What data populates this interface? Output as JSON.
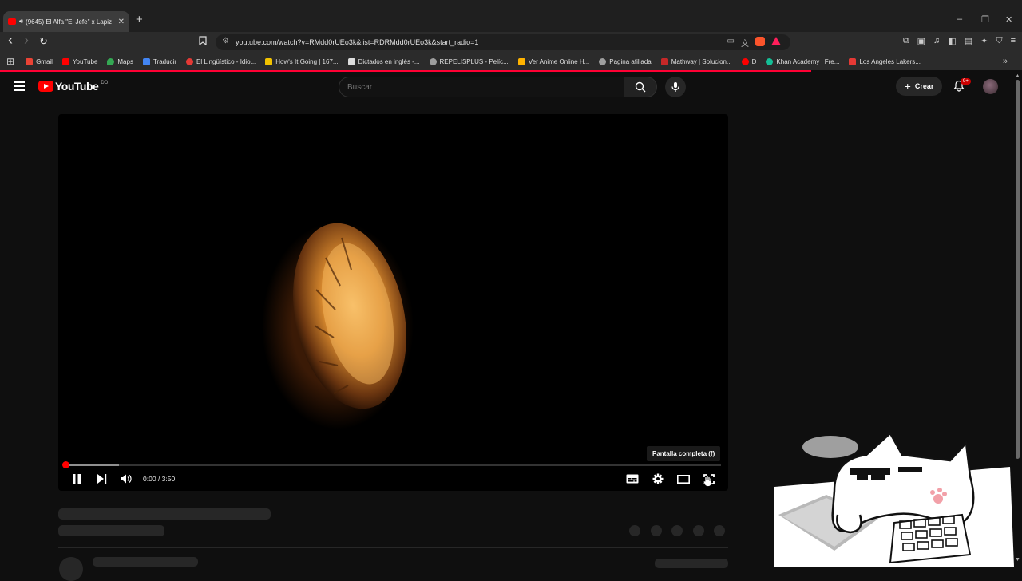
{
  "browser": {
    "tab": {
      "speaker_icon": "speaker-icon",
      "title": "(9645) El Alfa \"El Jefe\" x Lapiz",
      "close": "✕"
    },
    "new_tab": "+",
    "window_controls": [
      "–",
      "❐",
      "✕"
    ],
    "nav": {
      "back": "‹",
      "forward": "›",
      "reload": "↻"
    },
    "url": "youtube.com/watch?v=RMdd0rUEo3k&list=RDRMdd0rUEo3k&start_radio=1",
    "bookmarks": [
      {
        "label": "Gmail",
        "color": "#ea4335"
      },
      {
        "label": "YouTube",
        "color": "#ff0000"
      },
      {
        "label": "Maps",
        "color": "#34a853"
      },
      {
        "label": "Traducir",
        "color": "#4285f4"
      },
      {
        "label": "El Lingüístico - Idio...",
        "color": "#e53935"
      },
      {
        "label": "How's It Going | 167...",
        "color": "#f2c200"
      },
      {
        "label": "Dictados en inglés -...",
        "color": "#dddddd"
      },
      {
        "label": "REPELISPLUS - Pelíc...",
        "color": "#9e9e9e"
      },
      {
        "label": "Ver Anime Online H...",
        "color": "#ffb300"
      },
      {
        "label": "Pagina afiliada",
        "color": "#9e9e9e"
      },
      {
        "label": "Mathway | Solucion...",
        "color": "#c62828"
      },
      {
        "label": "D",
        "color": "#ff0000"
      },
      {
        "label": "Khan Academy | Fre...",
        "color": "#14bf96"
      },
      {
        "label": "Los Angeles Lakers...",
        "color": "#e53935"
      }
    ],
    "bookmarks_overflow": "»"
  },
  "youtube": {
    "logo_text": "YouTube",
    "country_code": "DO",
    "search_placeholder": "Buscar",
    "create_label": "Crear",
    "notifications_badge": "9+"
  },
  "player": {
    "tooltip": "Pantalla completa (f)",
    "current_time": "0:00",
    "duration": "3:50",
    "time_display": "0:00 / 3:50",
    "progress_fraction": 0.0,
    "buffer_fraction": 0.08,
    "state": "playing"
  },
  "colors": {
    "accent": "#ff0000",
    "background": "#0f0f0f",
    "surface": "#272727"
  }
}
